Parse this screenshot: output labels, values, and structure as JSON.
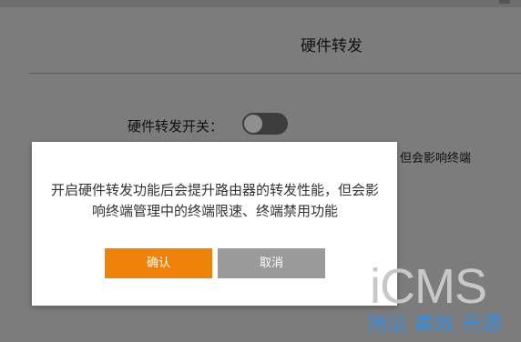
{
  "page": {
    "title": "硬件转发",
    "switch_label": "硬件转发开关：",
    "switch_state": "off",
    "hint_visible": "性能，但会影响终端"
  },
  "dialog": {
    "message": "开启硬件转发功能后会提升路由器的转发性能，但会影响终端管理中的终端限速、终端禁用功能",
    "confirm_label": "确认",
    "cancel_label": "取消"
  },
  "watermark": {
    "logo": "iCMS",
    "tagline": "简洁 高效 开源"
  },
  "colors": {
    "overlay": "#7c7c7c",
    "confirm": "#ef8208",
    "cancel": "#9a9a9a",
    "tagline": "#2f8ee6"
  }
}
